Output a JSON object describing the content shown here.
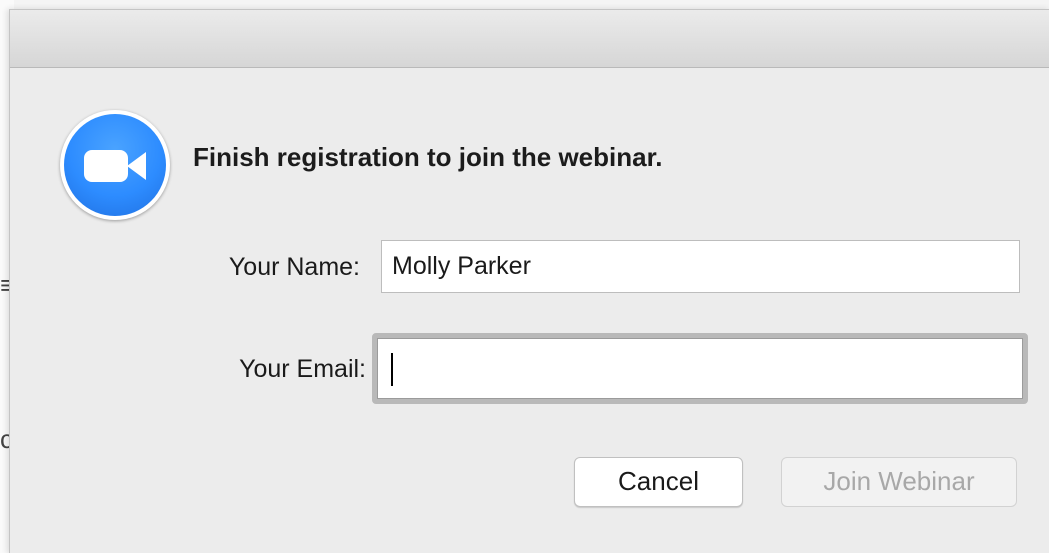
{
  "background_window": {
    "glyph_1": "≡",
    "glyph_2": "c"
  },
  "dialog": {
    "app_icon": "zoom-camera-icon",
    "heading": "Finish registration to join the webinar.",
    "fields": {
      "name": {
        "label": "Your Name:",
        "value": "Molly Parker"
      },
      "email": {
        "label": "Your Email:",
        "value": ""
      }
    },
    "buttons": {
      "cancel": "Cancel",
      "join": "Join Webinar"
    }
  },
  "colors": {
    "brand_blue": "#2d8cff",
    "dialog_bg": "#ececec",
    "disabled_text": "#a8a8a8",
    "focus_ring": "#b9b9b9"
  }
}
